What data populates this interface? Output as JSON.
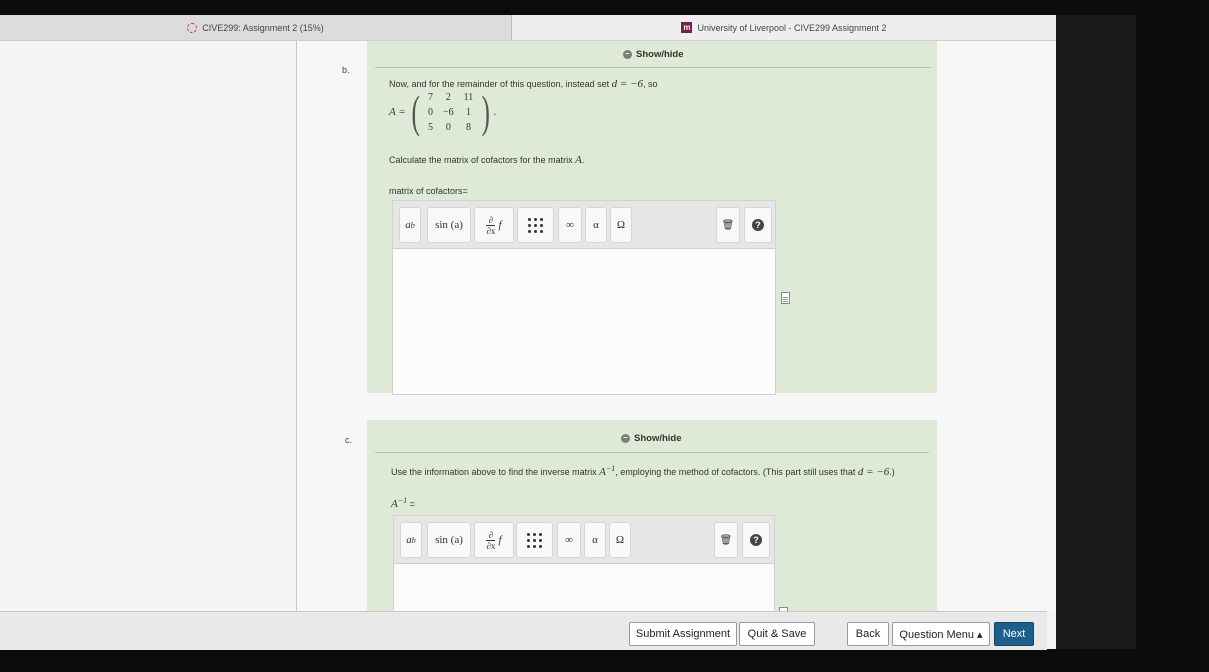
{
  "tabs": [
    {
      "label": "CIVE299: Assignment 2 (15%)",
      "icon": "moodle-icon"
    },
    {
      "label": "University of Liverpool - CIVE299 Assignment 2",
      "icon": "mobius-icon",
      "icon_text": "m"
    }
  ],
  "part_b": {
    "label": "b.",
    "showhide": "Show/hide",
    "intro_text": "Now, and for the remainder of this question, instead set",
    "intro_math": "d = −6",
    "intro_suffix": ", so",
    "matrix_lhs": "A =",
    "matrix": [
      [
        "7",
        "2",
        "11"
      ],
      [
        "0",
        "−6",
        "1"
      ],
      [
        "5",
        "0",
        "8"
      ]
    ],
    "matrix_tail": ".",
    "instruction": "Calculate the matrix of cofactors for the matrix",
    "instruction_math": "A",
    "instruction_tail": ".",
    "answer_label": "matrix of cofactors="
  },
  "part_c": {
    "label": "c.",
    "showhide": "Show/hide",
    "intro_text": "Use the information above to find the inverse matrix",
    "intro_math": "A",
    "intro_sup": "−1",
    "intro_mid": ", employing the method of cofactors. (This part still uses that",
    "intro_math2": "d = −6",
    "intro_tail": ".)",
    "answer_math": "A",
    "answer_sup": "−1",
    "answer_eq": " ="
  },
  "toolbar": {
    "power_base": "a",
    "power_exp": "b",
    "sin": "sin (a)",
    "deriv_num": "∂",
    "deriv_den": "∂x",
    "deriv_f": "f",
    "infinity": "∞",
    "alpha": "α",
    "omega": "Ω",
    "trash": "🗑",
    "help": "?"
  },
  "footer": {
    "submit": "Submit Assignment",
    "quit": "Quit & Save",
    "back": "Back",
    "menu": "Question Menu ▴",
    "next": "Next"
  },
  "colors": {
    "panel": "#dfead6",
    "next_button": "#1d5f8a"
  }
}
